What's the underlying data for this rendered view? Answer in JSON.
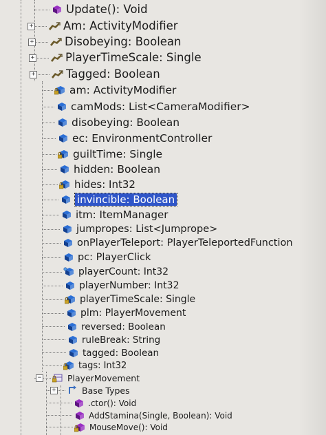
{
  "tree": {
    "rows": [
      {
        "label": "Update(): Void",
        "icon": "method-icon"
      },
      {
        "label": "Am: ActivityModifier",
        "icon": "property-icon",
        "expander": "+"
      },
      {
        "label": "Disobeying: Boolean",
        "icon": "property-icon",
        "expander": "+"
      },
      {
        "label": "PlayerTimeScale: Single",
        "icon": "property-icon",
        "expander": "+"
      },
      {
        "label": "Tagged: Boolean",
        "icon": "property-icon",
        "expander": "+"
      },
      {
        "label": "am: ActivityModifier",
        "icon": "protected-field-icon"
      },
      {
        "label": "camMods: List<CameraModifier>",
        "icon": "field-icon"
      },
      {
        "label": "disobeying: Boolean",
        "icon": "field-icon"
      },
      {
        "label": "ec: EnvironmentController",
        "icon": "field-icon"
      },
      {
        "label": "guiltTime: Single",
        "icon": "protected-field-icon"
      },
      {
        "label": "hidden: Boolean",
        "icon": "field-icon"
      },
      {
        "label": "hides: Int32",
        "icon": "protected-field-icon"
      },
      {
        "label": "invincible: Boolean",
        "icon": "field-icon",
        "selected": true
      },
      {
        "label": "itm: ItemManager",
        "icon": "field-icon"
      },
      {
        "label": "jumpropes: List<Jumprope>",
        "icon": "field-icon"
      },
      {
        "label": "onPlayerTeleport: PlayerTeleportedFunction",
        "icon": "field-icon"
      },
      {
        "label": "pc: PlayerClick",
        "icon": "field-icon"
      },
      {
        "label": "playerCount: Int32",
        "icon": "internal-field-icon"
      },
      {
        "label": "playerNumber: Int32",
        "icon": "field-icon"
      },
      {
        "label": "playerTimeScale: Single",
        "icon": "protected-field-icon"
      },
      {
        "label": "plm: PlayerMovement",
        "icon": "field-icon"
      },
      {
        "label": "reversed: Boolean",
        "icon": "field-icon"
      },
      {
        "label": "ruleBreak: String",
        "icon": "field-icon"
      },
      {
        "label": "tagged: Boolean",
        "icon": "field-icon"
      },
      {
        "label": "tags: Int32",
        "icon": "protected-field-icon"
      },
      {
        "label": "PlayerMovement",
        "icon": "class-icon",
        "expander": "−"
      },
      {
        "label": "Base Types",
        "icon": "base-types-icon",
        "expander": "+"
      },
      {
        "label": ".ctor(): Void",
        "icon": "method-icon"
      },
      {
        "label": "AddStamina(Single, Boolean): Void",
        "icon": "method-icon"
      },
      {
        "label": "MouseMove(): Void",
        "icon": "protected-method-icon"
      }
    ]
  },
  "colors": {
    "background": "#e8e6e2",
    "selection": "#2f55c8",
    "field_blue": "#2b6fd6",
    "method_purple": "#9a2fc4",
    "property_brown": "#6b5a2a",
    "lock_gold": "#c9a227"
  }
}
